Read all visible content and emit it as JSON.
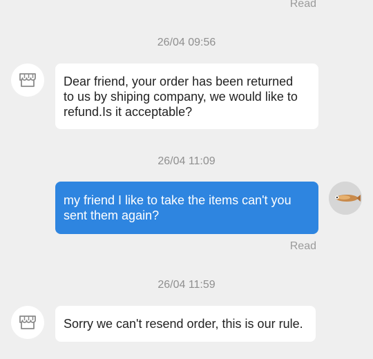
{
  "messages": [
    {
      "kind": "status",
      "text": "Read"
    },
    {
      "kind": "timestamp",
      "text": "26/04 09:56"
    },
    {
      "kind": "incoming",
      "lines": [
        "Dear friend, your order has been returned",
        "to us by shiping company, we would like to",
        "refund.Is it acceptable?"
      ]
    },
    {
      "kind": "timestamp",
      "text": "26/04 11:09"
    },
    {
      "kind": "outgoing",
      "lines": [
        "my friend I like to take the items can't you",
        "sent them again?"
      ]
    },
    {
      "kind": "status",
      "text": "Read"
    },
    {
      "kind": "timestamp",
      "text": "26/04 11:59"
    },
    {
      "kind": "incoming",
      "lines": [
        "Sorry we can't resend order, this is our rule."
      ]
    }
  ],
  "icons": {
    "seller_avatar": "store-icon",
    "user_avatar": "user-avatar-photo"
  },
  "colors": {
    "background": "#efefef",
    "incoming_bubble": "#ffffff",
    "outgoing_bubble": "#2e85e0",
    "status_text": "#9a9a9a"
  }
}
